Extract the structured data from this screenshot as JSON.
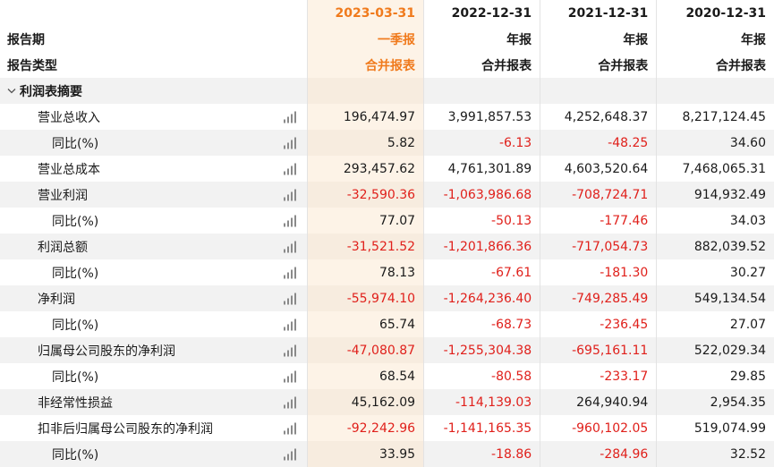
{
  "header": {
    "dates": [
      "2023-03-31",
      "2022-12-31",
      "2021-12-31",
      "2020-12-31"
    ],
    "period_label": "报告期",
    "periods": [
      "一季报",
      "年报",
      "年报",
      "年报"
    ],
    "type_label": "报告类型",
    "types": [
      "合并报表",
      "合并报表",
      "合并报表",
      "合并报表"
    ]
  },
  "section": {
    "toggle_icon": "chevron-down-icon",
    "title": "利润表摘要"
  },
  "rows": [
    {
      "label": "营业总收入",
      "level": 1,
      "values": [
        "196,474.97",
        "3,991,857.53",
        "4,252,648.37",
        "8,217,124.45"
      ]
    },
    {
      "label": "同比(%)",
      "level": 2,
      "values": [
        "5.82",
        "-6.13",
        "-48.25",
        "34.60"
      ]
    },
    {
      "label": "营业总成本",
      "level": 1,
      "values": [
        "293,457.62",
        "4,761,301.89",
        "4,603,520.64",
        "7,468,065.31"
      ]
    },
    {
      "label": "营业利润",
      "level": 1,
      "values": [
        "-32,590.36",
        "-1,063,986.68",
        "-708,724.71",
        "914,932.49"
      ]
    },
    {
      "label": "同比(%)",
      "level": 2,
      "values": [
        "77.07",
        "-50.13",
        "-177.46",
        "34.03"
      ]
    },
    {
      "label": "利润总额",
      "level": 1,
      "values": [
        "-31,521.52",
        "-1,201,866.36",
        "-717,054.73",
        "882,039.52"
      ]
    },
    {
      "label": "同比(%)",
      "level": 2,
      "values": [
        "78.13",
        "-67.61",
        "-181.30",
        "30.27"
      ]
    },
    {
      "label": "净利润",
      "level": 1,
      "values": [
        "-55,974.10",
        "-1,264,236.40",
        "-749,285.49",
        "549,134.54"
      ]
    },
    {
      "label": "同比(%)",
      "level": 2,
      "values": [
        "65.74",
        "-68.73",
        "-236.45",
        "27.07"
      ]
    },
    {
      "label": "归属母公司股东的净利润",
      "level": 1,
      "values": [
        "-47,080.87",
        "-1,255,304.38",
        "-695,161.11",
        "522,029.34"
      ]
    },
    {
      "label": "同比(%)",
      "level": 2,
      "values": [
        "68.54",
        "-80.58",
        "-233.17",
        "29.85"
      ]
    },
    {
      "label": "非经常性损益",
      "level": 1,
      "values": [
        "45,162.09",
        "-114,139.03",
        "264,940.94",
        "2,954.35"
      ]
    },
    {
      "label": "扣非后归属母公司股东的净利润",
      "level": 1,
      "values": [
        "-92,242.96",
        "-1,141,165.35",
        "-960,102.05",
        "519,074.99"
      ]
    },
    {
      "label": "同比(%)",
      "level": 2,
      "values": [
        "33.95",
        "-18.86",
        "-284.96",
        "32.52"
      ]
    }
  ],
  "colors": {
    "accent": "#f07a1c",
    "negative": "#e0201b",
    "stripe": "#f2f2f2",
    "highlight_column": "#fdf3e7"
  },
  "row_icon": "bar-chart-icon"
}
